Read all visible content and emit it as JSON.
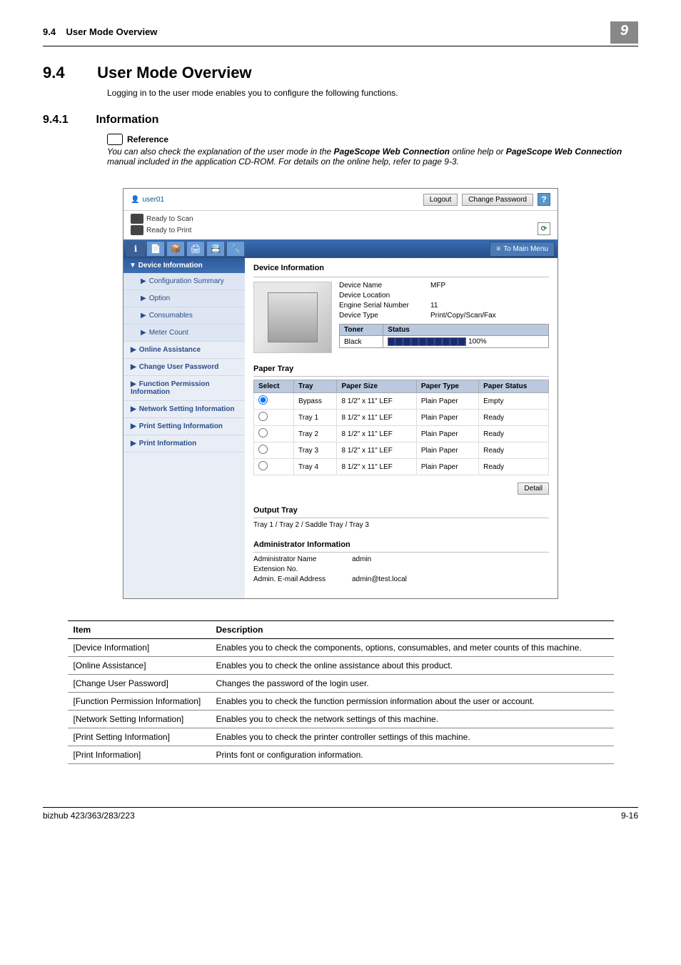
{
  "header": {
    "section_num": "9.4",
    "section_name": "User Mode Overview",
    "chapter_badge": "9"
  },
  "title": {
    "num": "9.4",
    "text": "User Mode Overview"
  },
  "intro": "Logging in to the user mode enables you to configure the following functions.",
  "subtitle": {
    "num": "9.4.1",
    "text": "Information"
  },
  "reference": {
    "head": "Reference",
    "text_before": "You can also check the explanation of the user mode in the ",
    "bold1": "PageScope Web Connection",
    "mid": " online help or ",
    "bold2": "PageScope Web Connection",
    "after": " manual included in the application CD-ROM. For details on the online help, refer to page 9-3."
  },
  "shot": {
    "user": "user01",
    "logout": "Logout",
    "change_pw": "Change Password",
    "help": "?",
    "status_scan": "Ready to Scan",
    "status_print": "Ready to Print",
    "refresh": "⟳",
    "to_main": "To Main Menu",
    "side_head": "▼ Device Information",
    "side": {
      "conf_sum": "Configuration Summary",
      "option": "Option",
      "consumables": "Consumables",
      "meter": "Meter Count",
      "online_assist": "Online Assistance",
      "change_pw": "Change User Password",
      "func_perm": "Function Permission Information",
      "net_set": "Network Setting Information",
      "print_set": "Print Setting Information",
      "print_info": "Print Information"
    },
    "dev_info_title": "Device Information",
    "dev": {
      "name_k": "Device Name",
      "name_v": "MFP",
      "loc_k": "Device Location",
      "loc_v": "",
      "serial_k": "Engine Serial Number",
      "serial_v": "11",
      "type_k": "Device Type",
      "type_v": "Print/Copy/Scan/Fax"
    },
    "toner": {
      "h1": "Toner",
      "h2": "Status",
      "black": "Black",
      "pct": "100%"
    },
    "paper_title": "Paper Tray",
    "paper_h": {
      "sel": "Select",
      "tray": "Tray",
      "size": "Paper Size",
      "type": "Paper Type",
      "status": "Paper Status"
    },
    "paper": [
      {
        "sel": true,
        "tray": "Bypass",
        "size": "8 1/2\" x 11\" LEF",
        "type": "Plain Paper",
        "status": "Empty"
      },
      {
        "sel": false,
        "tray": "Tray 1",
        "size": "8 1/2\" x 11\" LEF",
        "type": "Plain Paper",
        "status": "Ready"
      },
      {
        "sel": false,
        "tray": "Tray 2",
        "size": "8 1/2\" x 11\" LEF",
        "type": "Plain Paper",
        "status": "Ready"
      },
      {
        "sel": false,
        "tray": "Tray 3",
        "size": "8 1/2\" x 11\" LEF",
        "type": "Plain Paper",
        "status": "Ready"
      },
      {
        "sel": false,
        "tray": "Tray 4",
        "size": "8 1/2\" x 11\" LEF",
        "type": "Plain Paper",
        "status": "Ready"
      }
    ],
    "detail": "Detail",
    "output_title": "Output Tray",
    "output_text": "Tray 1 / Tray 2 / Saddle Tray / Tray 3",
    "admin_title": "Administrator Information",
    "admin": {
      "name_k": "Administrator Name",
      "name_v": "admin",
      "ext_k": "Extension No.",
      "ext_v": "",
      "mail_k": "Admin. E-mail Address",
      "mail_v": "admin@test.local"
    }
  },
  "desc_h": {
    "item": "Item",
    "desc": "Description"
  },
  "desc": [
    {
      "item": "[Device Information]",
      "desc": "Enables you to check the components, options, consumables, and meter counts of this machine."
    },
    {
      "item": "[Online Assistance]",
      "desc": "Enables you to check the online assistance about this product."
    },
    {
      "item": "[Change User Password]",
      "desc": "Changes the password of the login user."
    },
    {
      "item": "[Function Permission Information]",
      "desc": "Enables you to check the function permission information about the user or account."
    },
    {
      "item": "[Network Setting Information]",
      "desc": "Enables you to check the network settings of this machine."
    },
    {
      "item": "[Print Setting Information]",
      "desc": "Enables you to check the printer controller settings of this machine."
    },
    {
      "item": "[Print Information]",
      "desc": "Prints font or configuration information."
    }
  ],
  "footer": {
    "left": "bizhub 423/363/283/223",
    "right": "9-16"
  }
}
